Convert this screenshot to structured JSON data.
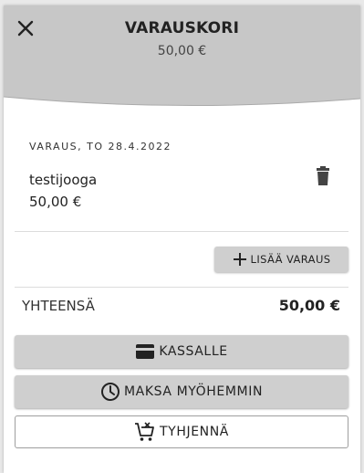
{
  "header": {
    "title": "VARAUSKORI",
    "subtitle": "50,00 €",
    "close_icon": "close-icon",
    "bg_color": "#c7c7c7"
  },
  "booking": {
    "date_label": "VARAUS, TO 28.4.2022",
    "item_name": "testijooga",
    "item_price": "50,00 €",
    "delete_icon": "trash-icon"
  },
  "add_booking": {
    "label": "LISÄÄ VARAUS",
    "icon": "plus-icon"
  },
  "total": {
    "label": "YHTEENSÄ",
    "value": "50,00 €"
  },
  "actions": {
    "checkout_label": "KASSALLE",
    "checkout_icon": "credit-card-icon",
    "pay_later_label": "MAKSA MYÖHEMMIN",
    "pay_later_icon": "clock-icon",
    "empty_label": "TYHJENNÄ",
    "empty_icon": "cart-remove-icon"
  },
  "colors": {
    "button_fill": "#cfcfcf",
    "panel_bg": "#ffffff"
  }
}
